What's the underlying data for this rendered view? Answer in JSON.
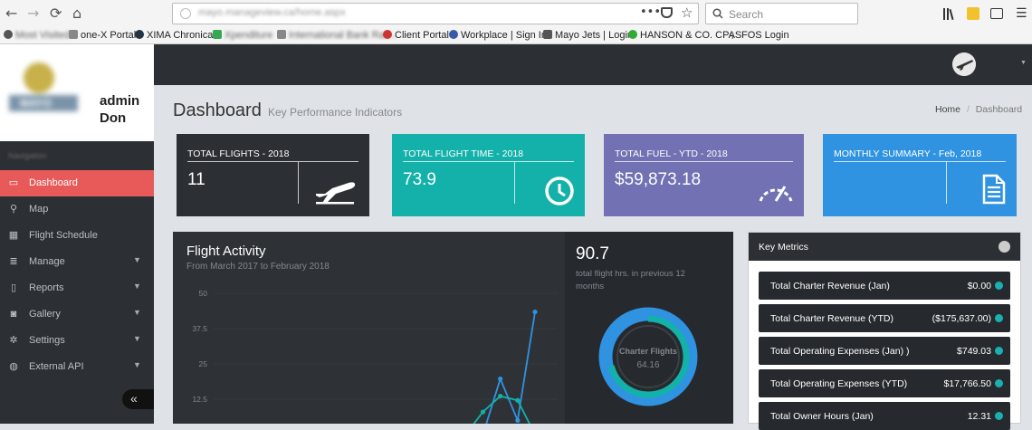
{
  "browser": {
    "url": "mayo.manageview.ca/home.aspx",
    "search_placeholder": "Search",
    "url_dots": "•••",
    "bookmarks": [
      {
        "label": "Most Visited",
        "icon": "gear-icon"
      },
      {
        "label": "one-X Portal",
        "icon": "page-icon"
      },
      {
        "label": "XIMA Chronical",
        "icon": "x-icon"
      },
      {
        "label": "Xpenditure",
        "icon": "green-x-icon"
      },
      {
        "label": "International Bank Rat...",
        "icon": "page-icon"
      },
      {
        "label": "Client Portal",
        "icon": "globe-icon"
      },
      {
        "label": "Workplace | Sign In",
        "icon": "shield-icon"
      },
      {
        "label": "Mayo Jets | Login",
        "icon": "lock-icon"
      },
      {
        "label": "HANSON & CO. CPAS",
        "icon": "green-s-icon"
      },
      {
        "label": "FOS Login",
        "icon": "tilde-icon"
      }
    ]
  },
  "brand": {
    "logo_text": "MAYO",
    "user_line1": "admin",
    "user_line2": "Don",
    "nav_heading": "Navigation"
  },
  "sidebar": {
    "items": [
      {
        "label": "Dashboard",
        "icon": "laptop-icon",
        "caret": false,
        "active": true
      },
      {
        "label": "Map",
        "icon": "map-marker-icon",
        "caret": false,
        "active": false
      },
      {
        "label": "Flight Schedule",
        "icon": "calendar-icon",
        "caret": false,
        "active": false
      },
      {
        "label": "Manage",
        "icon": "database-icon",
        "caret": true,
        "active": false
      },
      {
        "label": "Reports",
        "icon": "document-icon",
        "caret": true,
        "active": false
      },
      {
        "label": "Gallery",
        "icon": "camera-icon",
        "caret": true,
        "active": false
      },
      {
        "label": "Settings",
        "icon": "cogs-icon",
        "caret": true,
        "active": false
      },
      {
        "label": "External API",
        "icon": "globe-icon",
        "caret": true,
        "active": false
      }
    ],
    "collapse_label": "«"
  },
  "page": {
    "title": "Dashboard",
    "subtitle": "Key Performance Indicators",
    "breadcrumb": [
      "Home",
      "Dashboard"
    ]
  },
  "kpis": [
    {
      "title": "TOTAL FLIGHTS - 2018",
      "value": "11",
      "icon": "plane-takeoff-icon",
      "color": "#2c2f33"
    },
    {
      "title": "TOTAL FLIGHT TIME - 2018",
      "value": "73.9",
      "icon": "clock-icon",
      "color": "#14b1aa"
    },
    {
      "title": "TOTAL FUEL - YTD - 2018",
      "value": "$59,873.18",
      "icon": "gauge-icon",
      "color": "#7171b3"
    },
    {
      "title": "MONTHLY SUMMARY - Feb, 2018",
      "value": "",
      "icon": "file-text-icon",
      "color": "#2f93e2"
    }
  ],
  "flight_activity": {
    "title": "Flight Activity",
    "subtitle": "From March 2017 to February 2018",
    "total_value": "90.7",
    "total_caption": "total flight hrs. in previous 12 months",
    "donut_label": "Charter Flights",
    "donut_value": "64.16",
    "donut_fraction": 0.71
  },
  "chart_data": {
    "type": "line",
    "y_ticks": [
      "50",
      "37.5",
      "25",
      "12.5"
    ],
    "ylim": [
      0,
      50
    ],
    "series": [
      {
        "color": "#2f93e2",
        "values": [
          0,
          0,
          0,
          0,
          0,
          0,
          0,
          0,
          0,
          0,
          19.7,
          5,
          43.4
        ]
      },
      {
        "color": "#14b1aa",
        "values": [
          0,
          0,
          0,
          0,
          0,
          0,
          0,
          0,
          0,
          8,
          13.6,
          12.1,
          0
        ]
      }
    ]
  },
  "key_metrics": {
    "title": "Key Metrics",
    "items": [
      {
        "label": "Total Charter Revenue (Jan)",
        "value": "$0.00"
      },
      {
        "label": "Total Charter Revenue (YTD)",
        "value": "($175,637.00)"
      },
      {
        "label": "Total Operating Expenses (Jan) )",
        "value": "$749.03"
      },
      {
        "label": "Total Operating Expenses (YTD)",
        "value": "$17,766.50"
      },
      {
        "label": "Total Owner Hours (Jan)",
        "value": "12.31"
      }
    ]
  }
}
